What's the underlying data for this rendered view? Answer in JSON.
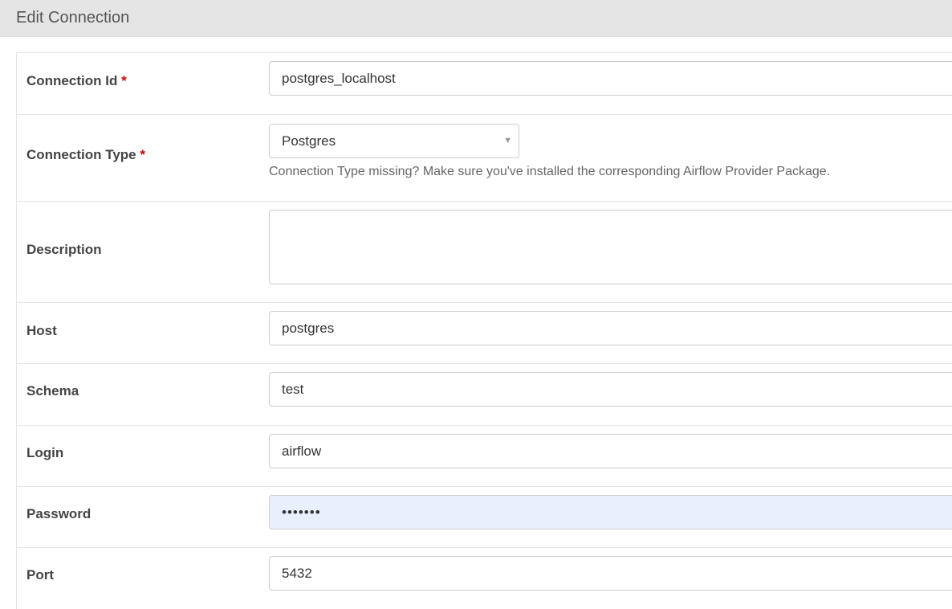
{
  "panel": {
    "title": "Edit Connection"
  },
  "required_mark": "*",
  "fields": {
    "conn_id": {
      "label": "Connection Id",
      "value": "postgres_localhost"
    },
    "conn_type": {
      "label": "Connection Type",
      "selected": "Postgres",
      "help": "Connection Type missing? Make sure you've installed the corresponding Airflow Provider Package."
    },
    "description": {
      "label": "Description",
      "value": ""
    },
    "host": {
      "label": "Host",
      "value": "postgres"
    },
    "schema": {
      "label": "Schema",
      "value": "test"
    },
    "login": {
      "label": "Login",
      "value": "airflow"
    },
    "password": {
      "label": "Password",
      "value": "•••••••"
    },
    "port": {
      "label": "Port",
      "value": "5432"
    }
  },
  "icons": {
    "select_caret": "chevron-down-icon"
  }
}
